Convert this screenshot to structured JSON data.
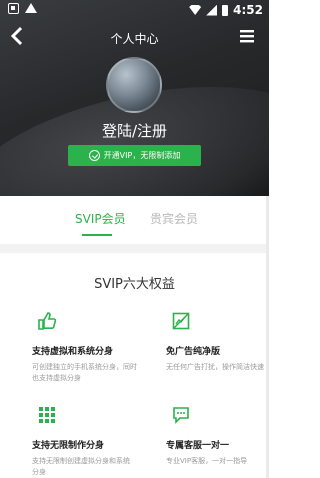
{
  "status": {
    "time": "4:52"
  },
  "nav": {
    "title": "个人中心"
  },
  "profile": {
    "login": "登陆/注册",
    "vip_button": "开通VIP，无限制添加"
  },
  "tabs": [
    {
      "label": "SVIP会员"
    },
    {
      "label": "贵宾会员"
    }
  ],
  "benefits": {
    "title": "SVIP六大权益",
    "items": [
      {
        "icon": "thumbs-up-icon",
        "title": "支持虚拟和系统分身",
        "desc": "可创建独立的手机系统分身，同时也支持虚拟分身"
      },
      {
        "icon": "no-ads-icon",
        "title": "免广告纯净版",
        "desc": "无任何广告打扰，操作简洁快速"
      },
      {
        "icon": "grid-icon",
        "title": "支持无限制作分身",
        "desc": "支持无限制创建虚拟分身和系统分身"
      },
      {
        "icon": "chat-icon",
        "title": "专属客服一对一",
        "desc": "专业VIP客服，一对一指导"
      }
    ]
  },
  "colors": {
    "accent": "#2bb24c",
    "hero": "#26282a"
  }
}
